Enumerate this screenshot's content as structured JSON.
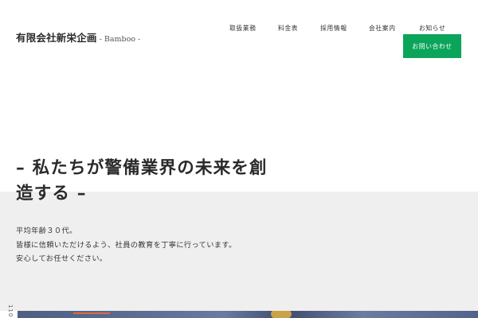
{
  "brand": {
    "name": "有限会社新栄企画",
    "sub": "- Bamboo -"
  },
  "nav": {
    "items": [
      {
        "label": "取扱業務"
      },
      {
        "label": "料金表"
      },
      {
        "label": "採用情報"
      },
      {
        "label": "会社案内"
      },
      {
        "label": "お知らせ"
      }
    ],
    "contact": "お問い合わせ"
  },
  "hero": {
    "title_line1": "– 私たちが警備業界の未来を創",
    "title_line2": "造する –",
    "desc": [
      "平均年齢３０代。",
      "皆様に信頼いただけるよう、社員の教育を丁寧に行っています。",
      "安心してお任せください。"
    ]
  },
  "side": {
    "text": "110"
  },
  "colors": {
    "accent": "#0aa55a",
    "band": "#efefef",
    "text": "#2b2b2b"
  }
}
